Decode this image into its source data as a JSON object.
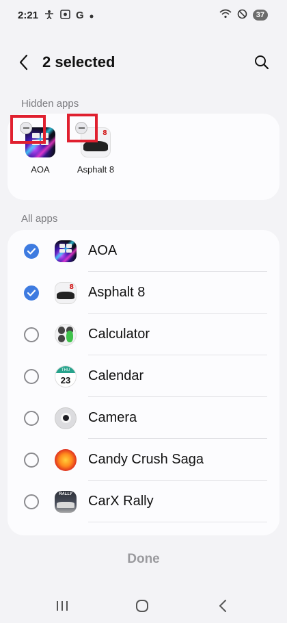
{
  "status_bar": {
    "time": "2:21",
    "left_icons": [
      "accessibility-icon",
      "screenshot-icon",
      "google-icon",
      "dot-icon"
    ],
    "google_letter": "G",
    "battery": "37"
  },
  "header": {
    "title": "2 selected"
  },
  "hidden_apps": {
    "label": "Hidden apps",
    "apps": [
      {
        "name": "AOA",
        "icon": "aoa-app-icon"
      },
      {
        "name": "Asphalt 8",
        "icon": "asphalt-app-icon"
      }
    ]
  },
  "all_apps": {
    "label": "All apps",
    "items": [
      {
        "name": "AOA",
        "checked": true,
        "icon": "aoa-app-icon"
      },
      {
        "name": "Asphalt 8",
        "checked": true,
        "icon": "asphalt-app-icon"
      },
      {
        "name": "Calculator",
        "checked": false,
        "icon": "calculator-app-icon"
      },
      {
        "name": "Calendar",
        "checked": false,
        "icon": "calendar-app-icon",
        "icon_text": "THU",
        "icon_day": "23"
      },
      {
        "name": "Camera",
        "checked": false,
        "icon": "camera-app-icon"
      },
      {
        "name": "Candy Crush Saga",
        "checked": false,
        "icon": "candy-crush-app-icon"
      },
      {
        "name": "CarX Rally",
        "checked": false,
        "icon": "carx-rally-app-icon",
        "icon_text": "RALLY"
      }
    ]
  },
  "footer": {
    "done_label": "Done"
  },
  "colors": {
    "accent": "#3e7be0",
    "highlight_box": "#e0202f",
    "background": "#f3f3f6",
    "card": "#fcfcfe"
  }
}
